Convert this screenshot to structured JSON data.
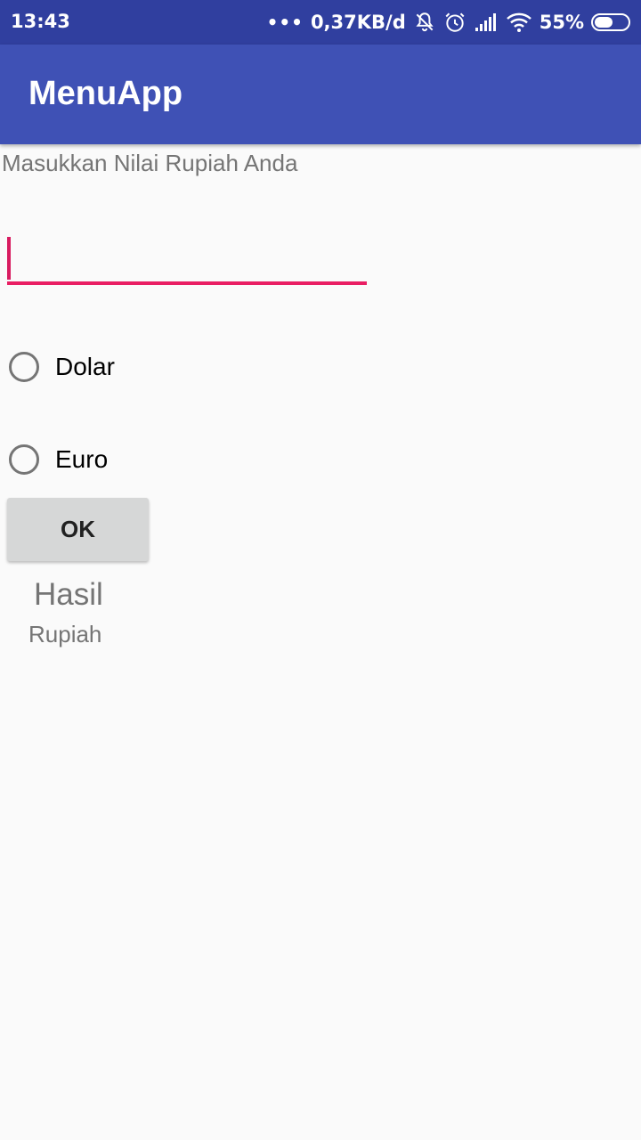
{
  "status_bar": {
    "time": "13:43",
    "dots": "•••",
    "network_speed": "0,37KB/d",
    "battery_percent": "55%",
    "battery_level": 0.55,
    "icons": [
      "notifications-off-icon",
      "alarm-icon",
      "signal-icon",
      "wifi-icon",
      "battery-icon"
    ]
  },
  "app_bar": {
    "title": "MenuApp",
    "color": "#3f51b5"
  },
  "form": {
    "prompt": "Masukkan Nilai Rupiah Anda",
    "input_value": "",
    "accent_color": "#e91e63",
    "options": [
      {
        "label": "Dolar",
        "selected": false
      },
      {
        "label": "Euro",
        "selected": false
      }
    ],
    "ok_label": "OK"
  },
  "result": {
    "title": "Hasil",
    "unit": "Rupiah"
  }
}
